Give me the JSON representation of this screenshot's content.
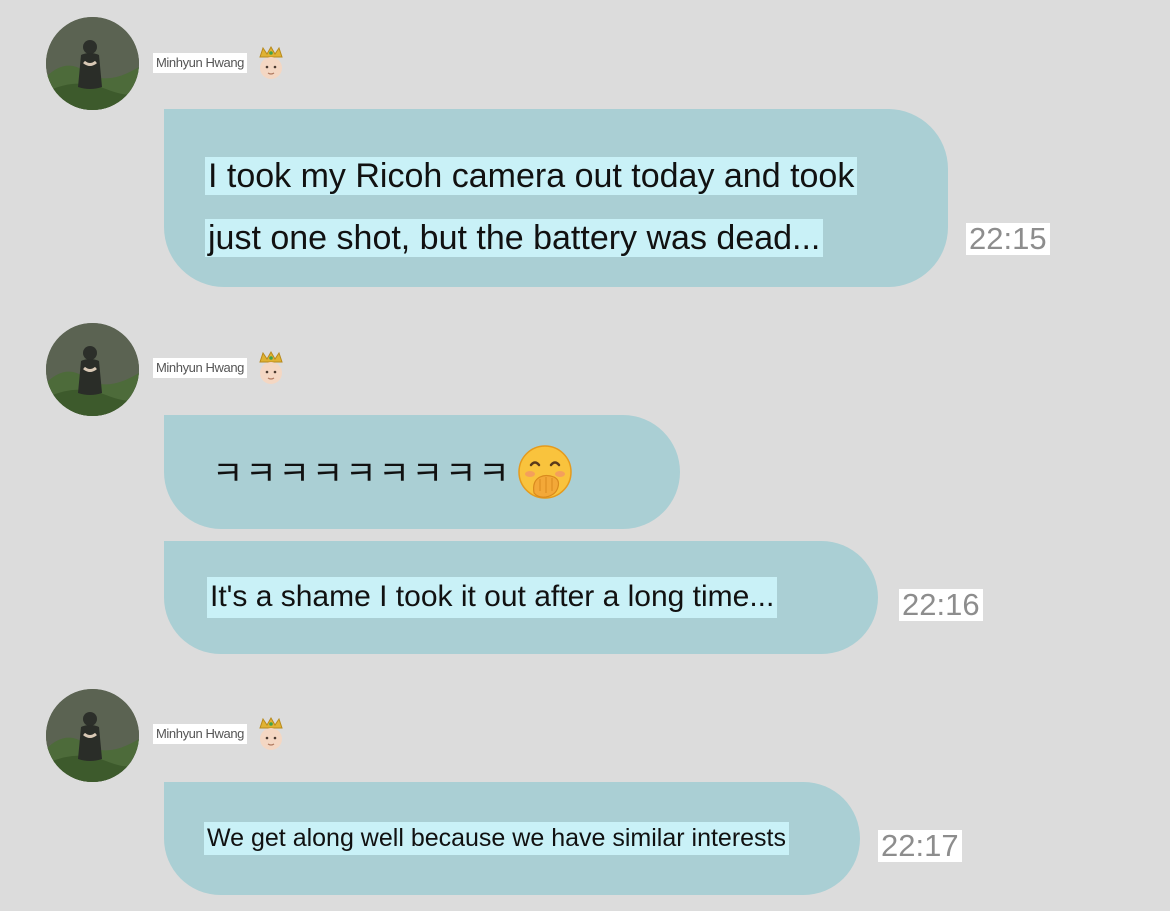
{
  "chat": {
    "messages": [
      {
        "sender": "Minhyun Hwang",
        "text_lines": [
          "I took my Ricoh camera out today and took",
          "just one shot, but the battery was dead..."
        ],
        "time": "22:15"
      },
      {
        "sender": "Minhyun Hwang",
        "laugh_text": "ㅋㅋㅋㅋㅋㅋㅋㅋㅋ",
        "emoji": "face-with-hand-over-mouth-icon",
        "text": "It's a shame I took it out after a long time...",
        "time": "22:16"
      },
      {
        "sender": "Minhyun Hwang",
        "text": "We get along well because we have similar interests",
        "time": "22:17"
      }
    ]
  },
  "colors": {
    "background": "#dcdcdc",
    "bubble": "#aacfd4",
    "text_highlight": "#c9f1f7",
    "timestamp_text": "#8d8d8d"
  },
  "icons": [
    "avatar",
    "crown-icon",
    "face-with-hand-over-mouth-icon"
  ]
}
